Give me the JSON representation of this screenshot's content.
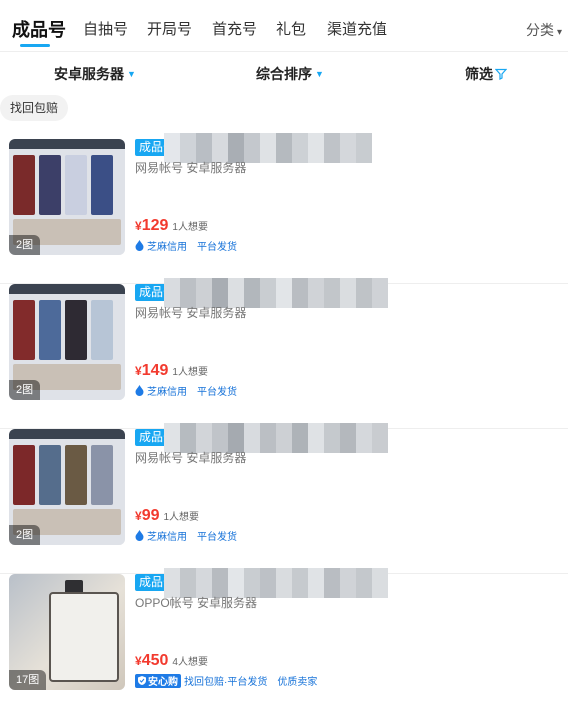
{
  "tabs": [
    {
      "label": "成品号"
    },
    {
      "label": "自抽号"
    },
    {
      "label": "开局号"
    },
    {
      "label": "首充号"
    },
    {
      "label": "礼包"
    },
    {
      "label": "渠道充值"
    }
  ],
  "category_label": "分类",
  "filters": {
    "server": "安卓服务器",
    "sort": "综合排序",
    "screen": "筛选"
  },
  "chip_label": "找回包赔",
  "listings": [
    {
      "badge": "成品号",
      "subtitle": "网易帐号  安卓服务器",
      "currency": "¥",
      "price": "129",
      "wants": "1人想要",
      "image_count": "2图",
      "tags": [
        "芝麻信用",
        "平台发货"
      ]
    },
    {
      "badge": "成品号",
      "subtitle": "网易帐号  安卓服务器",
      "currency": "¥",
      "price": "149",
      "wants": "1人想要",
      "image_count": "2图",
      "tags": [
        "芝麻信用",
        "平台发货"
      ]
    },
    {
      "badge": "成品号",
      "subtitle": "网易帐号  安卓服务器",
      "currency": "¥",
      "price": "99",
      "wants": "1人想要",
      "image_count": "2图",
      "tags": [
        "芝麻信用",
        "平台发货"
      ]
    },
    {
      "badge": "成品号",
      "subtitle": "OPPO帐号  安卓服务器",
      "currency": "¥",
      "price": "450",
      "wants": "4人想要",
      "image_count": "17图",
      "shield_label": "安心购",
      "tags": [
        "找回包赔·平台发货",
        "优质卖家"
      ]
    }
  ],
  "colors": {
    "accent": "#18a7f2",
    "price": "#f23a2e",
    "tag": "#1672d8"
  }
}
